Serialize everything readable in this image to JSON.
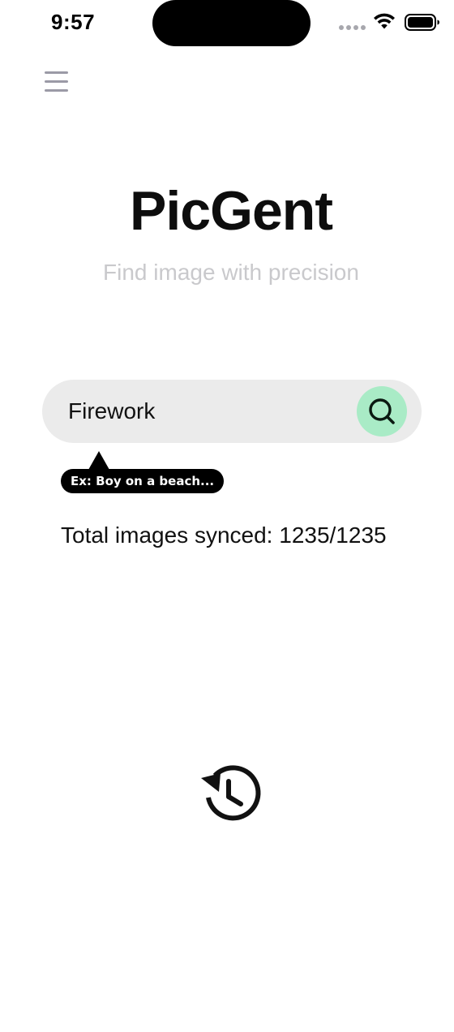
{
  "status_bar": {
    "time": "9:57",
    "icons": [
      "signal-dots-icon",
      "wifi-icon",
      "battery-icon"
    ]
  },
  "header": {
    "menu_icon": "hamburger-menu-icon"
  },
  "hero": {
    "title": "PicGent",
    "subtitle": "Find image with precision"
  },
  "search": {
    "value": "Firework",
    "placeholder": "",
    "button_icon": "search-icon"
  },
  "hint": {
    "text": "Ex: Boy on a beach..."
  },
  "sync": {
    "text": "Total images synced: 1235/1235"
  },
  "history": {
    "icon": "history-icon"
  },
  "colors": {
    "accent": "#a9ebc6",
    "search_bg": "#ebebeb",
    "subtitle": "#c9c9cc",
    "menu": "#9b9aa6",
    "tooltip_bg": "#000000"
  }
}
